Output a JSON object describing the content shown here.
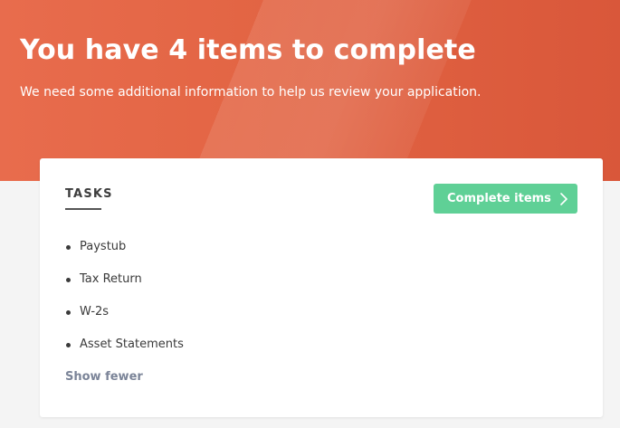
{
  "hero": {
    "title": "You have 4 items to complete",
    "subtitle": "We need some additional information to help us review your application."
  },
  "card": {
    "heading": "TASKS",
    "complete_button": {
      "label": "Complete items",
      "icon": "chevron-right-icon"
    },
    "tasks": [
      {
        "label": "Paystub"
      },
      {
        "label": "Tax Return"
      },
      {
        "label": "W-2s"
      },
      {
        "label": "Asset Statements"
      }
    ],
    "toggle_label": "Show fewer"
  },
  "colors": {
    "hero_background": "#e26443",
    "button_background": "#5fd096",
    "link": "#7b8498",
    "page_background": "#f4f4f4"
  }
}
